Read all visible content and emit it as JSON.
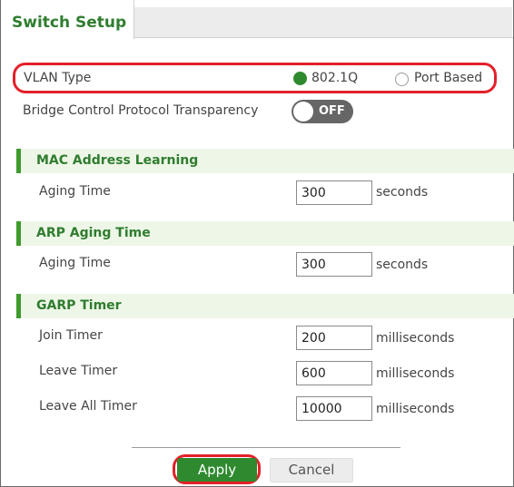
{
  "tab": {
    "title": "Switch Setup"
  },
  "vlan": {
    "label": "VLAN Type",
    "options": [
      {
        "label": "802.1Q",
        "selected": true
      },
      {
        "label": "Port Based",
        "selected": false
      }
    ]
  },
  "bpdu": {
    "label": "Bridge Control Protocol Transparency",
    "state": "OFF"
  },
  "mac_learning": {
    "title": "MAC Address Learning",
    "aging_label": "Aging Time",
    "aging_value": "300",
    "aging_unit": "seconds"
  },
  "arp": {
    "title": "ARP Aging Time",
    "aging_label": "Aging Time",
    "aging_value": "300",
    "aging_unit": "seconds"
  },
  "garp": {
    "title": "GARP Timer",
    "join_label": "Join Timer",
    "join_value": "200",
    "join_unit": "milliseconds",
    "leave_label": "Leave Timer",
    "leave_value": "600",
    "leave_unit": "milliseconds",
    "leave_all_label": "Leave All Timer",
    "leave_all_value": "10000",
    "leave_all_unit": "milliseconds"
  },
  "buttons": {
    "apply": "Apply",
    "cancel": "Cancel"
  },
  "colors": {
    "accent": "#2f8a2f",
    "highlight": "#e3202a"
  }
}
